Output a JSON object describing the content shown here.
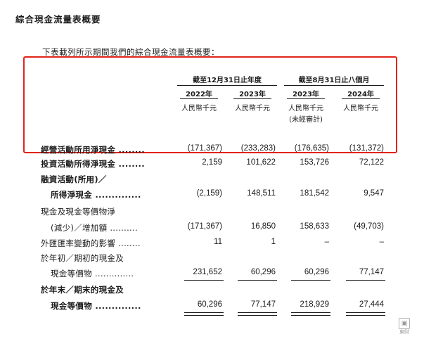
{
  "heading": "綜合現金流量表概要",
  "intro": "下表載列所示期間我們的綜合現金流量表概要：",
  "group_headers": [
    "截至12月31日止年度",
    "截至8月31日止八個月"
  ],
  "years": [
    "2022年",
    "2023年",
    "2023年",
    "2024年"
  ],
  "units": [
    "人民幣千元",
    "人民幣千元",
    "人民幣千元",
    "人民幣千元"
  ],
  "unaudited_note": "(未經審計)",
  "rows": [
    {
      "label": "經營活動所用淨現金",
      "dots": "........",
      "values": [
        "(171,367)",
        "(233,283)",
        "(176,635)",
        "(131,372)"
      ]
    },
    {
      "label": "投資活動所得淨現金",
      "dots": "........",
      "values": [
        "2,159",
        "101,622",
        "153,726",
        "72,122"
      ]
    },
    {
      "label": "融資活動(所用)／"
    },
    {
      "label": "所得淨現金",
      "dots": "..............",
      "values": [
        "(2,159)",
        "148,511",
        "181,542",
        "9,547"
      ]
    },
    {
      "label": "現金及現金等價物淨"
    },
    {
      "label": "(減少)／增加額",
      "dots": "..........",
      "values": [
        "(171,367)",
        "16,850",
        "158,633",
        "(49,703)"
      ]
    },
    {
      "label": "外匯匯率變動的影響",
      "dots": "........",
      "values": [
        "11",
        "1",
        "–",
        "–"
      ]
    },
    {
      "label": "於年初／期初的現金及"
    },
    {
      "label": "現金等價物",
      "dots": "..............",
      "values": [
        "231,652",
        "60,296",
        "60,296",
        "77,147"
      ]
    },
    {
      "label": "於年末／期末的現金及"
    },
    {
      "label": "現金等價物",
      "dots": "..............",
      "values": [
        "60,296",
        "77,147",
        "218,929",
        "27,444"
      ]
    }
  ],
  "watermark": {
    "icon": "logo-square-icon",
    "text": "東財"
  }
}
